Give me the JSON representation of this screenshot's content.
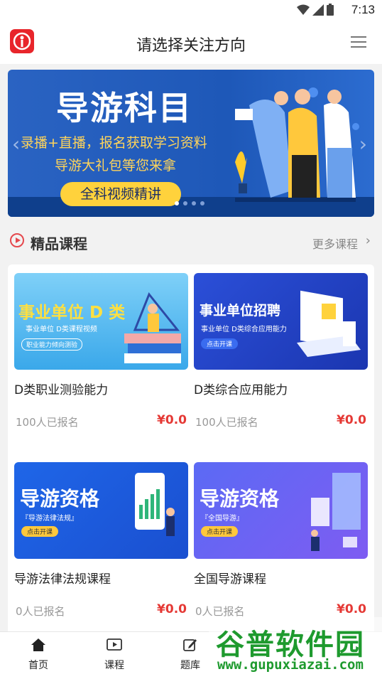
{
  "status": {
    "time": "7:13"
  },
  "header": {
    "title": "请选择关注方向"
  },
  "banner": {
    "heading": "导游科目",
    "line1": "录播+直播，报名获取学习资料",
    "line2": "导游大礼包等您来拿",
    "pill": "全科视频精讲",
    "slide_count": 4,
    "active_slide": 1
  },
  "section": {
    "title": "精品课程",
    "more": "更多课程"
  },
  "courses": [
    {
      "thumb_title": "事业单位 D 类",
      "thumb_sub": "事业单位  D类课程视频",
      "thumb_tag": "职业能力倾向测验",
      "name": "D类职业测验能力",
      "enrolled": "100人已报名",
      "price": "¥0.0"
    },
    {
      "thumb_title": "事业单位招聘",
      "thumb_sub": "事业单位 D类综合应用能力",
      "thumb_tag": "点击开课",
      "name": "D类综合应用能力",
      "enrolled": "100人已报名",
      "price": "¥0.0"
    },
    {
      "thumb_title": "导游资格",
      "thumb_sub": "『导游法律法规』",
      "thumb_tag": "点击开课",
      "name": "导游法律法规课程",
      "enrolled": "0人已报名",
      "price": "¥0.0"
    },
    {
      "thumb_title": "导游资格",
      "thumb_sub": "『全国导游』",
      "thumb_tag": "点击开课",
      "name": "全国导游课程",
      "enrolled": "0人已报名",
      "price": "¥0.0"
    }
  ],
  "tabs": [
    {
      "label": "首页",
      "icon": "home-icon"
    },
    {
      "label": "课程",
      "icon": "video-icon"
    },
    {
      "label": "题库",
      "icon": "edit-icon"
    }
  ],
  "watermark": {
    "big": "谷普软件园",
    "small": "www.gupuxiazai.com"
  }
}
